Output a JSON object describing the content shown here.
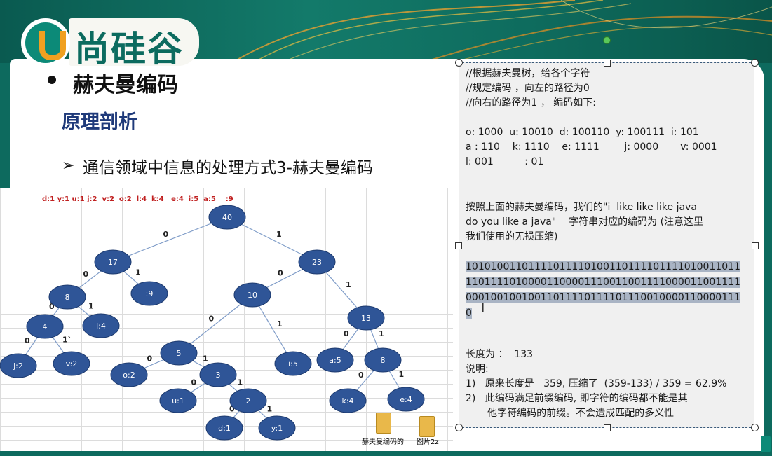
{
  "header": {
    "logo_text": "尚硅谷"
  },
  "slide": {
    "title": "赫夫曼编码",
    "subtitle": "原理剖析",
    "point": "通信领域中信息的处理方式3-赫夫曼编码"
  },
  "diagram": {
    "frequency_row": "d:1 y:1 u:1 j:2  v:2  o:2  l:4  k:4   e:4  i:5  a:5    :9",
    "nodes": [
      {
        "id": "n40",
        "label": "40"
      },
      {
        "id": "n17",
        "label": "17"
      },
      {
        "id": "n23",
        "label": "23"
      },
      {
        "id": "n8",
        "label": "8"
      },
      {
        "id": "nsp",
        "label": ":9"
      },
      {
        "id": "n10",
        "label": "10"
      },
      {
        "id": "n13",
        "label": "13"
      },
      {
        "id": "n4",
        "label": "4"
      },
      {
        "id": "nl",
        "label": "l:4"
      },
      {
        "id": "n5",
        "label": "5"
      },
      {
        "id": "ni",
        "label": "i:5"
      },
      {
        "id": "na",
        "label": "a:5"
      },
      {
        "id": "n8b",
        "label": "8"
      },
      {
        "id": "nj",
        "label": "j:2"
      },
      {
        "id": "nv",
        "label": "v:2"
      },
      {
        "id": "no",
        "label": "o:2"
      },
      {
        "id": "n3",
        "label": "3"
      },
      {
        "id": "nk",
        "label": "k:4"
      },
      {
        "id": "ne",
        "label": "e:4"
      },
      {
        "id": "nu",
        "label": "u:1"
      },
      {
        "id": "n2",
        "label": "2"
      },
      {
        "id": "nd",
        "label": "d:1"
      },
      {
        "id": "ny",
        "label": "y:1"
      }
    ],
    "edges": [
      {
        "from": "n40",
        "to": "n17",
        "label": "0"
      },
      {
        "from": "n40",
        "to": "n23",
        "label": "1"
      },
      {
        "from": "n17",
        "to": "n8",
        "label": "0"
      },
      {
        "from": "n17",
        "to": "nsp",
        "label": "1"
      },
      {
        "from": "n23",
        "to": "n10",
        "label": "0"
      },
      {
        "from": "n23",
        "to": "n13",
        "label": "1"
      },
      {
        "from": "n8",
        "to": "n4",
        "label": "0"
      },
      {
        "from": "n8",
        "to": "nl",
        "label": "1"
      },
      {
        "from": "n4",
        "to": "nj",
        "label": "0"
      },
      {
        "from": "n4",
        "to": "nv",
        "label": "1`"
      },
      {
        "from": "n10",
        "to": "n5",
        "label": "0"
      },
      {
        "from": "n10",
        "to": "ni",
        "label": "1"
      },
      {
        "from": "n13",
        "to": "na",
        "label": "0"
      },
      {
        "from": "n13",
        "to": "n8b",
        "label": "1"
      },
      {
        "from": "n5",
        "to": "no",
        "label": "0"
      },
      {
        "from": "n5",
        "to": "n3",
        "label": "1"
      },
      {
        "from": "n8b",
        "to": "nk",
        "label": "0"
      },
      {
        "from": "n8b",
        "to": "ne",
        "label": "1"
      },
      {
        "from": "n3",
        "to": "nu",
        "label": "0"
      },
      {
        "from": "n3",
        "to": "n2",
        "label": "1"
      },
      {
        "from": "n2",
        "to": "nd",
        "label": "0"
      },
      {
        "from": "n2",
        "to": "ny",
        "label": "1"
      }
    ],
    "files": [
      {
        "label": "赫夫曼编码的"
      },
      {
        "label": "图片2z"
      }
    ],
    "node_color": "#2f5597",
    "edge_color": "#7f9cc8"
  },
  "panel": {
    "comment_lines": [
      "//根据赫夫曼树，给各个字符",
      "//规定编码 ，向左的路径为0",
      "//向右的路径为1 ， 编码如下:"
    ],
    "code_lines": [
      "o: 1000  u: 10010  d: 100110  y: 100111  i: 101",
      "a : 110    k: 1110    e: 1111        j: 0000       v: 0001",
      "l: 001          : 01"
    ],
    "description_lines": [
      "按照上面的赫夫曼编码，我们的\"i  like like like java",
      "do you like a java\"    字符串对应的编码为 (注意这里",
      "我们使用的无损压缩)"
    ],
    "encoded_lines": [
      "10101001101111011110100110111101111010011011",
      "11011110100001100001110011001111000011001111",
      "00010010010011011110111101110010000110000111",
      "0"
    ],
    "length_label": "长度为 ：  133",
    "explain_label": "说明:",
    "notes": [
      "1)   原来长度是   359, 压缩了  (359-133) / 359 = 62.9%",
      "2)   此编码满足前缀编码, 即字符的编码都不能是其",
      "       他字符编码的前缀。不会造成匹配的多义性"
    ]
  }
}
